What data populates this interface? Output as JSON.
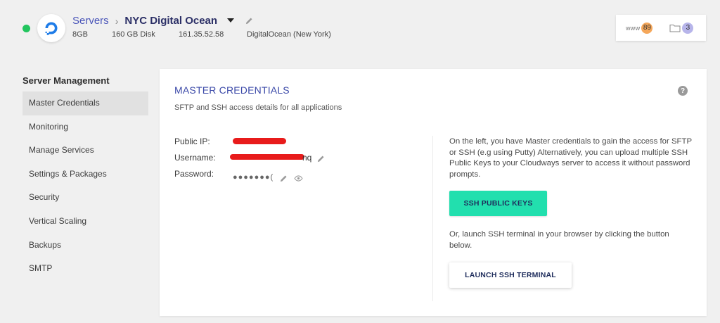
{
  "header": {
    "status_color": "#22c55e",
    "logo_icon": "digitalocean-logo-icon",
    "breadcrumb_servers": "Servers",
    "server_name": "NYC Digital Ocean",
    "meta": {
      "ram": "8GB",
      "disk": "160 GB Disk",
      "ip": "161.35.52.58",
      "provider": "DigitalOcean (New York)"
    },
    "badges": {
      "www_label": "www",
      "www_count": "89",
      "folder_icon": "folder-icon",
      "folder_count": "3"
    }
  },
  "sidebar": {
    "title": "Server Management",
    "items": [
      {
        "label": "Master Credentials",
        "active": true
      },
      {
        "label": "Monitoring"
      },
      {
        "label": "Manage Services"
      },
      {
        "label": "Settings & Packages"
      },
      {
        "label": "Security"
      },
      {
        "label": "Vertical Scaling"
      },
      {
        "label": "Backups"
      },
      {
        "label": "SMTP"
      }
    ]
  },
  "panel": {
    "title": "MASTER CREDENTIALS",
    "subtitle": "SFTP and SSH access details for all applications",
    "help_icon": "question-icon",
    "credentials": {
      "public_ip_label": "Public IP:",
      "username_label": "Username:",
      "username_visible_tail": "nq",
      "password_label": "Password:",
      "password_masked": "●●●●●●●(",
      "redaction_color": "#e81b1b"
    },
    "info_text": "On the left, you have Master credentials to gain the access for SFTP or SSH (e.g using Putty) Alternatively, you can upload multiple SSH Public Keys to your Cloudways server to access it without password prompts.",
    "ssh_keys_button": "SSH PUBLIC KEYS",
    "launch_info": "Or, launch SSH terminal in your browser by clicking the button below.",
    "launch_button": "LAUNCH SSH TERMINAL",
    "accent_color": "#22dfae",
    "title_color": "#3b49a8"
  }
}
